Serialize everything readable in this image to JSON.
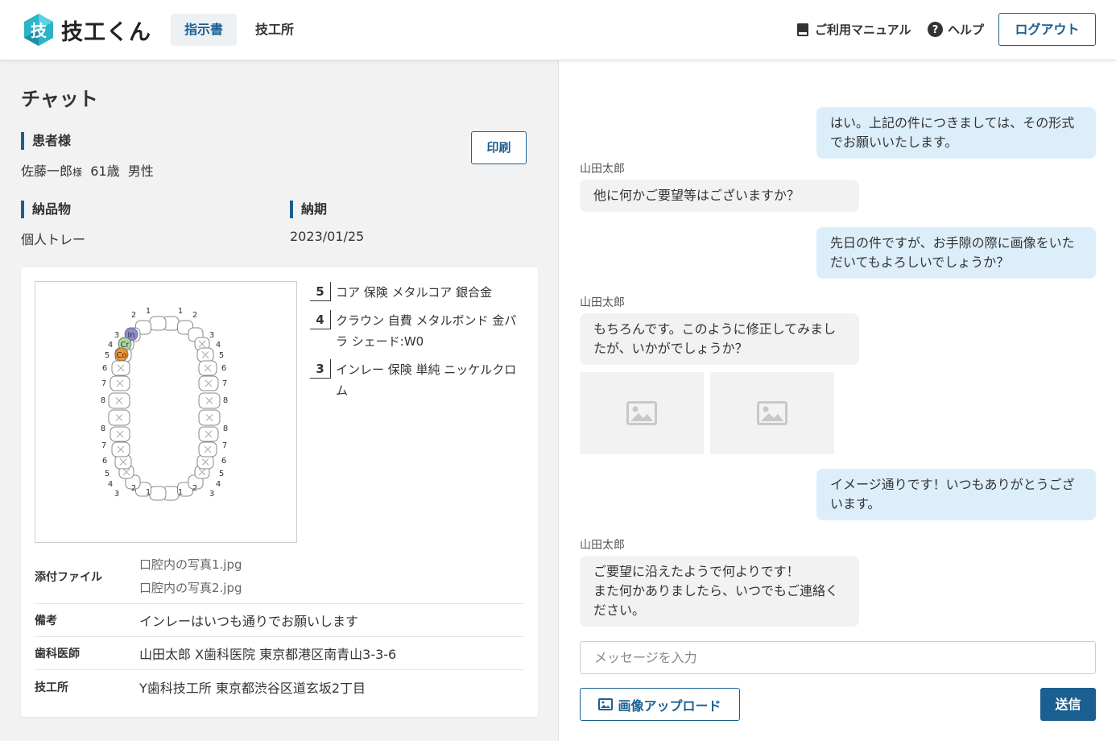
{
  "header": {
    "logo_text": "技工くん",
    "tabs": [
      {
        "label": "指示書",
        "active": true
      },
      {
        "label": "技工所",
        "active": false
      }
    ],
    "manual_label": "ご利用マニュアル",
    "help_label": "ヘルプ",
    "logout_label": "ログアウト"
  },
  "left": {
    "title": "チャット",
    "patient": {
      "label": "患者様",
      "name": "佐藤一郎",
      "honorific": "様",
      "age": "61歳",
      "gender": "男性"
    },
    "print_label": "印刷",
    "delivery": {
      "label": "納品物",
      "value": "個人トレー"
    },
    "deadline": {
      "label": "納期",
      "value": "2023/01/25"
    },
    "tooth_chart": {
      "upper_left_numbers": [
        "1",
        "2",
        "3",
        "4",
        "5",
        "6",
        "7",
        "8"
      ],
      "upper_right_numbers": [
        "1",
        "2",
        "3",
        "4",
        "5",
        "6",
        "7",
        "8"
      ],
      "markers": [
        "In",
        "Cr",
        "Co"
      ]
    },
    "treatments": [
      {
        "num": "5",
        "text": "コア 保険 メタルコア 銀合金"
      },
      {
        "num": "4",
        "text": "クラウン 自費 メタルボンド 金パラ シェード:W0"
      },
      {
        "num": "3",
        "text": "インレー 保険 単純 ニッケルクロム"
      }
    ],
    "info": {
      "attachments_label": "添付ファイル",
      "attachments": [
        "口腔内の写真1.jpg",
        "口腔内の写真2.jpg"
      ],
      "remarks_label": "備考",
      "remarks": "インレーはいつも通りでお願いします",
      "dentist_label": "歯科医師",
      "dentist": "山田太郎 X歯科医院 東京都港区南青山3-3-6",
      "lab_label": "技工所",
      "lab": "Y歯科技工所 東京都渋谷区道玄坂2丁目"
    }
  },
  "chat": {
    "messages": [
      {
        "from": "me",
        "text": "はい。上記の件につきましては、その形式でお願いいたします。"
      },
      {
        "from": "them",
        "sender": "山田太郎",
        "text": "他に何かご要望等はございますか？"
      },
      {
        "from": "me",
        "text": "先日の件ですが、お手隙の際に画像をいただいてもよろしいでしょうか？"
      },
      {
        "from": "them",
        "sender": "山田太郎",
        "text": "もちろんです。このように修正してみましたが、いかがでしょうか？"
      },
      {
        "from": "me",
        "text": "イメージ通りです！いつもありがとうございます。"
      },
      {
        "from": "them",
        "sender": "山田太郎",
        "text": "ご要望に沿えたようで何よりです！\nまた何かありましたら、いつでもご連絡ください。"
      }
    ],
    "input_placeholder": "メッセージを入力",
    "upload_label": "画像アップロード",
    "send_label": "送信"
  },
  "colors": {
    "accent": "#1a5f91",
    "bubble_me": "#ddeefb",
    "bubble_them": "#f2f2f2"
  }
}
